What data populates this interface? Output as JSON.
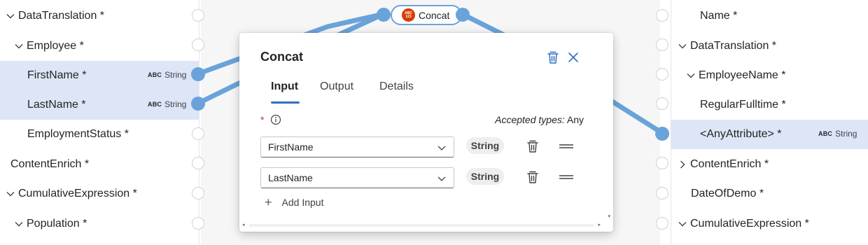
{
  "left_tree": [
    {
      "label": "DataTranslation *",
      "chevron": "down",
      "indent": 0,
      "selected": false,
      "type": null
    },
    {
      "label": "Employee *",
      "chevron": "down",
      "indent": 1,
      "selected": false,
      "type": null
    },
    {
      "label": "FirstName *",
      "chevron": null,
      "indent": 2,
      "selected": true,
      "type": "String"
    },
    {
      "label": "LastName *",
      "chevron": null,
      "indent": 2,
      "selected": true,
      "type": "String"
    },
    {
      "label": "EmploymentStatus *",
      "chevron": null,
      "indent": 2,
      "selected": false,
      "type": null
    },
    {
      "label": "ContentEnrich *",
      "chevron": null,
      "indent": 0,
      "selected": false,
      "type": null
    },
    {
      "label": "CumulativeExpression *",
      "chevron": "down",
      "indent": 0,
      "selected": false,
      "type": null
    },
    {
      "label": "Population *",
      "chevron": "down",
      "indent": 1,
      "selected": false,
      "type": null
    }
  ],
  "right_tree": [
    {
      "label": "Name *",
      "chevron": null,
      "indent": 1,
      "selected": false,
      "type": null
    },
    {
      "label": "DataTranslation *",
      "chevron": "down",
      "indent": 0,
      "selected": false,
      "type": null
    },
    {
      "label": "EmployeeName *",
      "chevron": "down",
      "indent": 1,
      "selected": false,
      "type": null
    },
    {
      "label": "RegularFulltime *",
      "chevron": null,
      "indent": 2,
      "selected": false,
      "type": null
    },
    {
      "label": "<AnyAttribute> *",
      "chevron": null,
      "indent": 2,
      "selected": true,
      "type": "String"
    },
    {
      "label": "ContentEnrich *",
      "chevron": "right",
      "indent": 0,
      "selected": false,
      "type": null
    },
    {
      "label": "DateOfDemo *",
      "chevron": null,
      "indent": 1,
      "selected": false,
      "type": null
    },
    {
      "label": "CumulativeExpression *",
      "chevron": "down",
      "indent": 0,
      "selected": false,
      "type": null
    }
  ],
  "type_badge_text": "ABC",
  "function_node": {
    "label": "Concat",
    "badge_text": "ABC 123",
    "badge_color": "#d83b01"
  },
  "dialog": {
    "title": "Concat",
    "tabs": [
      {
        "label": "Input",
        "active": true
      },
      {
        "label": "Output",
        "active": false
      },
      {
        "label": "Details",
        "active": false
      }
    ],
    "required_marker": "*",
    "accepted_prefix": "Accepted types:",
    "accepted_value": "Any",
    "inputs": [
      {
        "value": "FirstName",
        "type": "String"
      },
      {
        "value": "LastName",
        "type": "String"
      }
    ],
    "add_input_label": "Add Input"
  },
  "colors": {
    "accent": "#2f6fc4",
    "wire": "#6aa3d9",
    "selected_row": "#dce6f7",
    "function_badge": "#d83b01"
  }
}
